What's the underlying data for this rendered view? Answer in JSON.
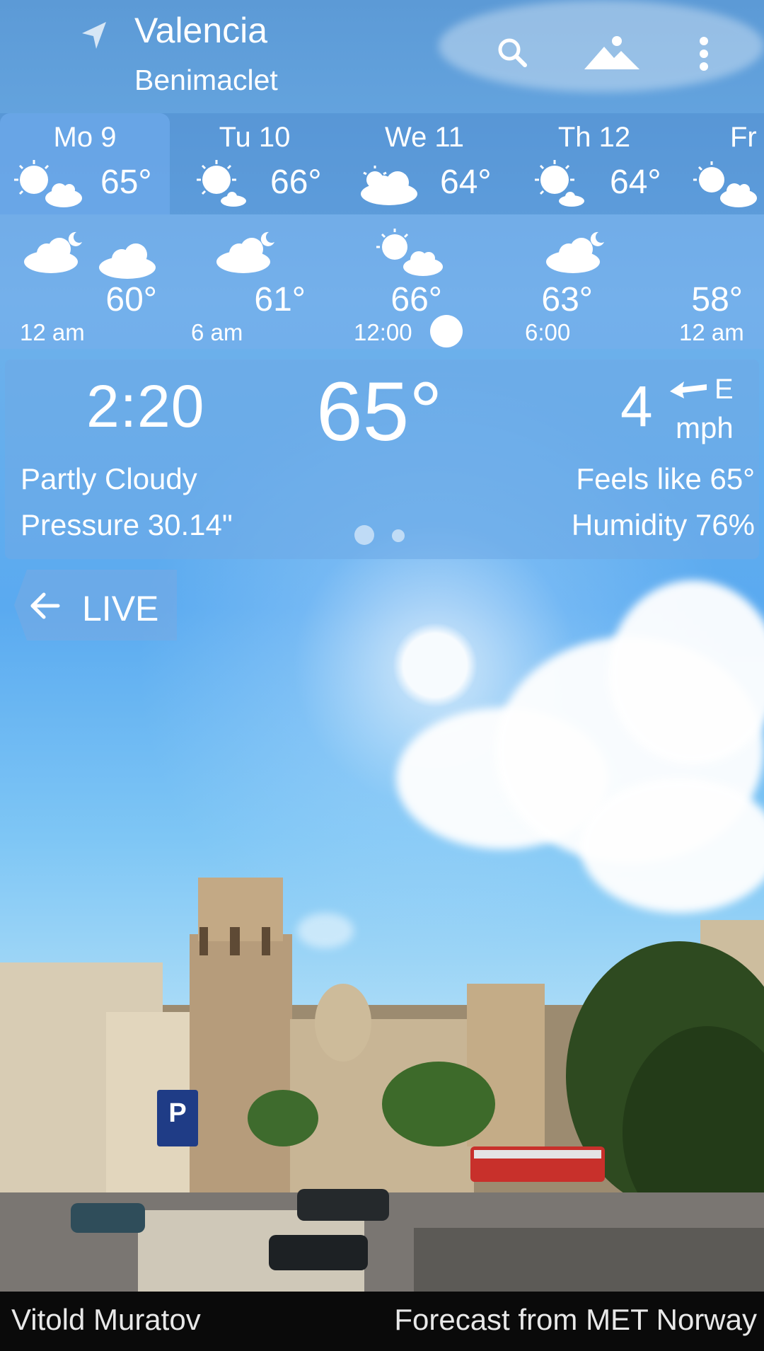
{
  "header": {
    "city": "Valencia",
    "suburb": "Benimaclet",
    "icons": [
      "location-arrow-icon",
      "search-icon",
      "landscape-icon",
      "more-vert-icon"
    ]
  },
  "days": [
    {
      "label": "Mo 9",
      "temp": "65°",
      "icon": "partly-cloudy-icon",
      "selected": true
    },
    {
      "label": "Tu 10",
      "temp": "66°",
      "icon": "sunny-with-small-cloud-icon"
    },
    {
      "label": "We 11",
      "temp": "64°",
      "icon": "mostly-cloudy-sun-icon"
    },
    {
      "label": "Th 12",
      "temp": "64°",
      "icon": "sunny-with-small-cloud-icon"
    },
    {
      "label": "Fr",
      "temp": "",
      "icon": "partly-cloudy-icon"
    }
  ],
  "hours": {
    "temps": [
      "60°",
      "61°",
      "66°",
      "63°",
      "58°"
    ],
    "times": [
      "12 am",
      "6 am",
      "12:00",
      "6:00",
      "12 am"
    ],
    "icons": [
      "cloudy-night-icon",
      "cloud-icon",
      "cloudy-night-icon",
      "partly-cloudy-icon",
      "cloudy-night-icon"
    ]
  },
  "current": {
    "time": "2:20",
    "temp": "65°",
    "wind_speed": "4",
    "wind_dir": "E",
    "wind_unit": "mph",
    "condition": "Partly Cloudy",
    "pressure": "Pressure 30.14\"",
    "feels_like": "Feels like 65°",
    "humidity": "Humidity 76%",
    "page_indicator": {
      "pages": 2,
      "active": 1
    }
  },
  "live_button": {
    "label": "LIVE"
  },
  "footer": {
    "credit": "Vitold Muratov",
    "source": "Forecast from MET Norway"
  },
  "colors": {
    "sky": "#5aaaf0",
    "panel": "#6eaae6",
    "footer": "#0a0a0a"
  }
}
